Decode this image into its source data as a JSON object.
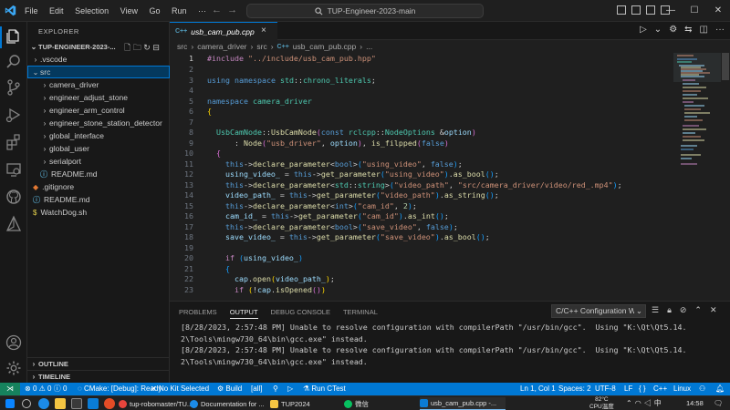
{
  "titlebar": {
    "menu": [
      "File",
      "Edit",
      "Selection",
      "View",
      "Go",
      "Run",
      "···"
    ],
    "search_text": "TUP-Engineer-2023-main"
  },
  "explorer": {
    "header": "EXPLORER",
    "workspace": "TUP-ENGINEER-2023-...",
    "items": [
      {
        "label": ".vscode",
        "kind": "folder"
      },
      {
        "label": "src",
        "kind": "folder-open"
      },
      {
        "label": "camera_driver",
        "kind": "folder"
      },
      {
        "label": "engineer_adjust_stone",
        "kind": "folder"
      },
      {
        "label": "engineer_arm_control",
        "kind": "folder"
      },
      {
        "label": "engineer_stone_station_detector",
        "kind": "folder"
      },
      {
        "label": "global_interface",
        "kind": "folder"
      },
      {
        "label": "global_user",
        "kind": "folder"
      },
      {
        "label": "serialport",
        "kind": "folder"
      },
      {
        "label": "README.md",
        "kind": "info"
      },
      {
        "label": ".gitignore",
        "kind": "git"
      },
      {
        "label": "README.md",
        "kind": "info"
      },
      {
        "label": "WatchDog.sh",
        "kind": "sh"
      }
    ],
    "outline": "OUTLINE",
    "timeline": "TIMELINE"
  },
  "editor": {
    "tab_label": "usb_cam_pub.cpp",
    "tab_badge": "C++",
    "breadcrumb": [
      "src",
      "›",
      "camera_driver",
      "›",
      "src",
      "›",
      "usb_cam_pub.cpp",
      "›",
      "..."
    ],
    "line_numbers": [
      "1",
      "2",
      "3",
      "4",
      "5",
      "6",
      "7",
      "8",
      "9",
      "10",
      "11",
      "12",
      "13",
      "14",
      "15",
      "16",
      "17",
      "18",
      "19",
      "20",
      "21",
      "22",
      "23"
    ]
  },
  "panel": {
    "tabs": [
      "PROBLEMS",
      "OUTPUT",
      "DEBUG CONSOLE",
      "TERMINAL"
    ],
    "active_tab": "OUTPUT",
    "channel": "C/C++ Configuration W",
    "output_lines": [
      "[8/28/2023, 2:57:48 PM] Unable to resolve configuration with compilerPath \"/usr/bin/gcc\".  Using \"K:\\Qt\\Qt5.14.",
      "2\\Tools\\mingw730_64\\bin\\gcc.exe\" instead.",
      "[8/28/2023, 2:57:48 PM] Unable to resolve configuration with compilerPath \"/usr/bin/gcc\".  Using \"K:\\Qt\\Qt5.14.",
      "2\\Tools\\mingw730_64\\bin\\gcc.exe\" instead."
    ]
  },
  "statusbar": {
    "errors": "0",
    "warnings": "0",
    "info": "0",
    "cmake": "CMake: [Debug]: Ready",
    "kit": "No Kit Selected",
    "build": "Build",
    "all": "[all]",
    "ctest": "Run CTest",
    "position": "Ln 1, Col 1",
    "spaces": "Spaces: 2",
    "encoding": "UTF-8",
    "eol": "LF",
    "language": "C++",
    "os": "Linux"
  },
  "taskbar": {
    "apps": [
      "tup-robomaster/TU...",
      "Documentation for ...",
      "TUP2024",
      "微信",
      "usb_cam_pub.cpp -..."
    ],
    "weather_temp": "82°C",
    "weather_label": "CPU温度",
    "time": "14:58"
  },
  "colors": {
    "accent": "#0078d4",
    "statusbar": "#0078d4",
    "remote": "#16825d",
    "selection": "#04395e"
  }
}
